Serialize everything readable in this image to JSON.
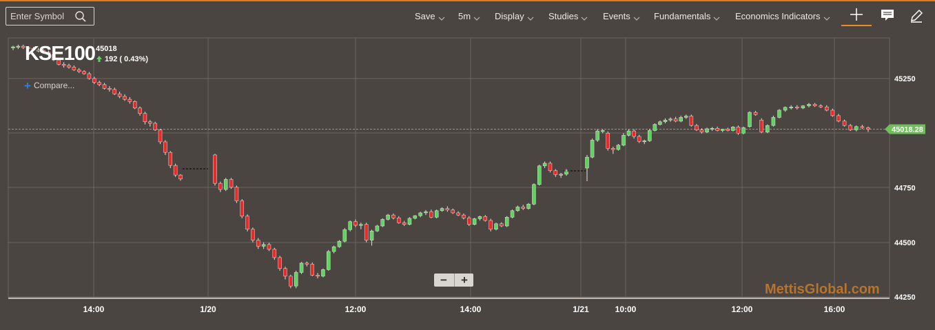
{
  "search": {
    "placeholder": "Enter Symbol",
    "icon": "search-icon"
  },
  "menu": [
    {
      "label": "Save",
      "name": "save"
    },
    {
      "label": "5m",
      "name": "interval"
    },
    {
      "label": "Display",
      "name": "display"
    },
    {
      "label": "Studies",
      "name": "studies"
    },
    {
      "label": "Events",
      "name": "events"
    },
    {
      "label": "Fundamentals",
      "name": "fundamentals"
    },
    {
      "label": "Economics Indicators",
      "name": "economics-indicators"
    }
  ],
  "tools": [
    "crosshair-icon",
    "comment-icon",
    "pencil-icon"
  ],
  "colors": {
    "accent": "#e07a1c",
    "up": "#5fd35f",
    "down": "#e82a2a",
    "background": "#4a4540",
    "grid": "#6a6560",
    "current_price_tag": "#6fbf5a"
  },
  "header": {
    "symbol": "KSE100",
    "price": "45018",
    "change": "192 ( 0.43%)",
    "change_direction": "up",
    "compare_label": "Compare..."
  },
  "zoom": {
    "minus": "−",
    "plus": "+"
  },
  "watermark": "MettisGlobal.com",
  "chart_data": {
    "type": "candlestick",
    "y_ticks": [
      "45250",
      "44750",
      "44500",
      "44250"
    ],
    "ylim": [
      44250,
      45450
    ],
    "current_price": "45018.28",
    "x_ticks": [
      "14:00",
      "1/20",
      "12:00",
      "14:00",
      "1/21",
      "10:00",
      "12:00",
      "16:00"
    ],
    "grid": true,
    "candles": [
      [
        45395,
        45400,
        45380,
        45395
      ],
      [
        45395,
        45405,
        45385,
        45398
      ],
      [
        45398,
        45405,
        45385,
        45392
      ],
      [
        45392,
        45398,
        45380,
        45388
      ],
      [
        45388,
        45395,
        45375,
        45380
      ],
      [
        45380,
        45390,
        45370,
        45378
      ],
      [
        45378,
        45385,
        45365,
        45370
      ],
      [
        45370,
        45378,
        45355,
        45360
      ],
      [
        45360,
        45368,
        45330,
        45335
      ],
      [
        45335,
        45342,
        45310,
        45315
      ],
      [
        45315,
        45325,
        45300,
        45310
      ],
      [
        45310,
        45318,
        45295,
        45302
      ],
      [
        45302,
        45310,
        45285,
        45290
      ],
      [
        45290,
        45298,
        45275,
        45282
      ],
      [
        45282,
        45288,
        45268,
        45272
      ],
      [
        45272,
        45280,
        45245,
        45250
      ],
      [
        45250,
        45258,
        45225,
        45232
      ],
      [
        45232,
        45240,
        45215,
        45222
      ],
      [
        45222,
        45230,
        45200,
        45205
      ],
      [
        45205,
        45215,
        45190,
        45200
      ],
      [
        45200,
        45208,
        45175,
        45180
      ],
      [
        45180,
        45190,
        45160,
        45168
      ],
      [
        45168,
        45178,
        45148,
        45155
      ],
      [
        45155,
        45165,
        45135,
        45145
      ],
      [
        45145,
        45150,
        45110,
        45115
      ],
      [
        45115,
        45122,
        45080,
        45090
      ],
      [
        45090,
        45098,
        45040,
        45052
      ],
      [
        45052,
        45060,
        45030,
        45045
      ],
      [
        45045,
        45052,
        45010,
        45015
      ],
      [
        45015,
        45020,
        44950,
        44960
      ],
      [
        44960,
        44968,
        44900,
        44912
      ],
      [
        44912,
        44918,
        44840,
        44852
      ],
      [
        44852,
        44860,
        44800,
        44808
      ],
      [
        44808,
        44812,
        44782,
        44790
      ],
      [
        44900,
        44905,
        44760,
        44770
      ],
      [
        44770,
        44778,
        44730,
        44742
      ],
      [
        44742,
        44795,
        44735,
        44788
      ],
      [
        44788,
        44795,
        44745,
        44752
      ],
      [
        44752,
        44760,
        44680,
        44690
      ],
      [
        44690,
        44698,
        44610,
        44620
      ],
      [
        44620,
        44628,
        44550,
        44560
      ],
      [
        44560,
        44568,
        44500,
        44510
      ],
      [
        44510,
        44520,
        44470,
        44482
      ],
      [
        44482,
        44500,
        44470,
        44490
      ],
      [
        44490,
        44498,
        44460,
        44468
      ],
      [
        44468,
        44475,
        44420,
        44430
      ],
      [
        44430,
        44438,
        44370,
        44380
      ],
      [
        44380,
        44388,
        44330,
        44345
      ],
      [
        44345,
        44352,
        44290,
        44300
      ],
      [
        44300,
        44370,
        44290,
        44362
      ],
      [
        44362,
        44410,
        44355,
        44405
      ],
      [
        44405,
        44412,
        44390,
        44400
      ],
      [
        44400,
        44408,
        44345,
        44350
      ],
      [
        44350,
        44360,
        44335,
        44345
      ],
      [
        44345,
        44380,
        44340,
        44375
      ],
      [
        44375,
        44465,
        44370,
        44458
      ],
      [
        44458,
        44485,
        44450,
        44480
      ],
      [
        44480,
        44510,
        44475,
        44505
      ],
      [
        44505,
        44565,
        44500,
        44558
      ],
      [
        44558,
        44600,
        44550,
        44595
      ],
      [
        44595,
        44605,
        44570,
        44578
      ],
      [
        44578,
        44590,
        44560,
        44582
      ],
      [
        44582,
        44590,
        44500,
        44510
      ],
      [
        44510,
        44558,
        44485,
        44552
      ],
      [
        44552,
        44580,
        44548,
        44575
      ],
      [
        44575,
        44610,
        44570,
        44605
      ],
      [
        44605,
        44630,
        44600,
        44625
      ],
      [
        44625,
        44632,
        44605,
        44612
      ],
      [
        44612,
        44620,
        44585,
        44590
      ],
      [
        44590,
        44598,
        44575,
        44582
      ],
      [
        44582,
        44615,
        44578,
        44610
      ],
      [
        44610,
        44625,
        44605,
        44622
      ],
      [
        44622,
        44640,
        44615,
        44635
      ],
      [
        44635,
        44648,
        44625,
        44640
      ],
      [
        44640,
        44650,
        44610,
        44615
      ],
      [
        44615,
        44650,
        44610,
        44645
      ],
      [
        44645,
        44660,
        44640,
        44655
      ],
      [
        44655,
        44665,
        44640,
        44648
      ],
      [
        44648,
        44655,
        44630,
        44635
      ],
      [
        44635,
        44642,
        44620,
        44625
      ],
      [
        44625,
        44632,
        44605,
        44612
      ],
      [
        44612,
        44620,
        44575,
        44582
      ],
      [
        44582,
        44612,
        44578,
        44608
      ],
      [
        44608,
        44622,
        44600,
        44618
      ],
      [
        44618,
        44625,
        44595,
        44600
      ],
      [
        44600,
        44608,
        44550,
        44560
      ],
      [
        44560,
        44590,
        44555,
        44585
      ],
      [
        44585,
        44592,
        44570,
        44575
      ],
      [
        44575,
        44620,
        44570,
        44615
      ],
      [
        44615,
        44650,
        44610,
        44645
      ],
      [
        44645,
        44668,
        44640,
        44662
      ],
      [
        44662,
        44672,
        44648,
        44655
      ],
      [
        44655,
        44680,
        44650,
        44675
      ],
      [
        44675,
        44770,
        44670,
        44765
      ],
      [
        44765,
        44855,
        44760,
        44850
      ],
      [
        44850,
        44870,
        44840,
        44862
      ],
      [
        44862,
        44870,
        44820,
        44828
      ],
      [
        44828,
        44835,
        44800,
        44810
      ],
      [
        44810,
        44818,
        44795,
        44812
      ],
      [
        44812,
        44835,
        44805,
        44830
      ],
      [
        44840,
        44900,
        44780,
        44890
      ],
      [
        44890,
        44975,
        44885,
        44968
      ],
      [
        44968,
        45018,
        44960,
        45010
      ],
      [
        45010,
        45018,
        45000,
        45012
      ],
      [
        45000,
        45008,
        44920,
        44930
      ],
      [
        44930,
        44938,
        44905,
        44925
      ],
      [
        44925,
        44950,
        44920,
        44945
      ],
      [
        44945,
        45000,
        44940,
        44990
      ],
      [
        44990,
        45018,
        44985,
        45010
      ],
      [
        45010,
        45018,
        44975,
        44985
      ],
      [
        44985,
        44992,
        44955,
        44962
      ],
      [
        44962,
        44970,
        44950,
        44965
      ],
      [
        44965,
        45020,
        44960,
        45012
      ],
      [
        45012,
        45045,
        45008,
        45040
      ],
      [
        45040,
        45058,
        45035,
        45052
      ],
      [
        45052,
        45068,
        45045,
        45060
      ],
      [
        45060,
        45072,
        45052,
        45065
      ],
      [
        45065,
        45075,
        45050,
        45055
      ],
      [
        45055,
        45080,
        45050,
        45072
      ],
      [
        45072,
        45085,
        45065,
        45078
      ],
      [
        45078,
        45085,
        45030,
        45035
      ],
      [
        45035,
        45042,
        45010,
        45015
      ],
      [
        45015,
        45022,
        44998,
        45005
      ],
      [
        45005,
        45025,
        45000,
        45020
      ],
      [
        45020,
        45028,
        45010,
        45022
      ],
      [
        45022,
        45030,
        45008,
        45012
      ],
      [
        45012,
        45020,
        45005,
        45018
      ],
      [
        45018,
        45025,
        45008,
        45012
      ],
      [
        45012,
        45032,
        45008,
        45028
      ],
      [
        45028,
        45035,
        44992,
        45000
      ],
      [
        45000,
        45030,
        44995,
        45025
      ],
      [
        45030,
        45100,
        45025,
        45095
      ],
      [
        45095,
        45102,
        45080,
        45085
      ],
      [
        45060,
        45068,
        45000,
        45005
      ],
      [
        45005,
        45040,
        45000,
        45035
      ],
      [
        45035,
        45080,
        45030,
        45072
      ],
      [
        45072,
        45110,
        45068,
        45105
      ],
      [
        45105,
        45122,
        45098,
        45118
      ],
      [
        45118,
        45128,
        45108,
        45120
      ],
      [
        45120,
        45128,
        45108,
        45115
      ],
      [
        45115,
        45128,
        45110,
        45125
      ],
      [
        45125,
        45138,
        45118,
        45132
      ],
      [
        45132,
        45138,
        45120,
        45125
      ],
      [
        45125,
        45132,
        45115,
        45120
      ],
      [
        45120,
        45128,
        45100,
        45105
      ],
      [
        45105,
        45112,
        45075,
        45080
      ],
      [
        45080,
        45088,
        45050,
        45055
      ],
      [
        45055,
        45062,
        45030,
        45035
      ],
      [
        45035,
        45042,
        45010,
        45015
      ],
      [
        45015,
        45035,
        45008,
        45030
      ],
      [
        45030,
        45038,
        45020,
        45025
      ],
      [
        45025,
        45030,
        45005,
        45018
      ]
    ]
  }
}
